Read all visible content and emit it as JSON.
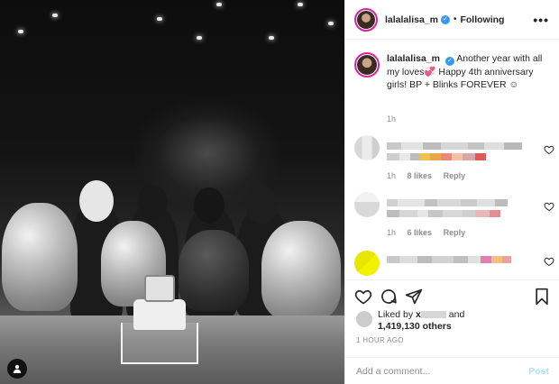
{
  "post": {
    "username": "lalalalisa_m",
    "follow_status": "Following",
    "separator": "•",
    "more_glyph": "•••",
    "verified_glyph": "✓"
  },
  "caption": {
    "username": "lalalalisa_m",
    "text": "Another year with all my loves💞 Happy 4th anniversary girls! BP + Blinks FOREVER ☺",
    "time": "1h"
  },
  "comments": [
    {
      "time": "1h",
      "likes": "8 likes",
      "reply": "Reply"
    },
    {
      "time": "1h",
      "likes": "6 likes",
      "reply": "Reply"
    },
    {
      "time": "",
      "likes": "",
      "reply": ""
    }
  ],
  "likes": {
    "prefix": "Liked by ",
    "partial_name": "x",
    "suffix": " and",
    "count": "1,419,130 others"
  },
  "timestamp": "1 HOUR AGO",
  "comment_box": {
    "placeholder": "Add a comment...",
    "post_label": "Post"
  },
  "colors": {
    "accent": "#3897f0",
    "muted": "#8e8e8e",
    "post_disabled": "#b2dffc"
  },
  "icons": [
    "heart-icon",
    "comment-icon",
    "share-icon",
    "bookmark-icon",
    "more-icon",
    "verified-icon",
    "user-tag-icon"
  ]
}
